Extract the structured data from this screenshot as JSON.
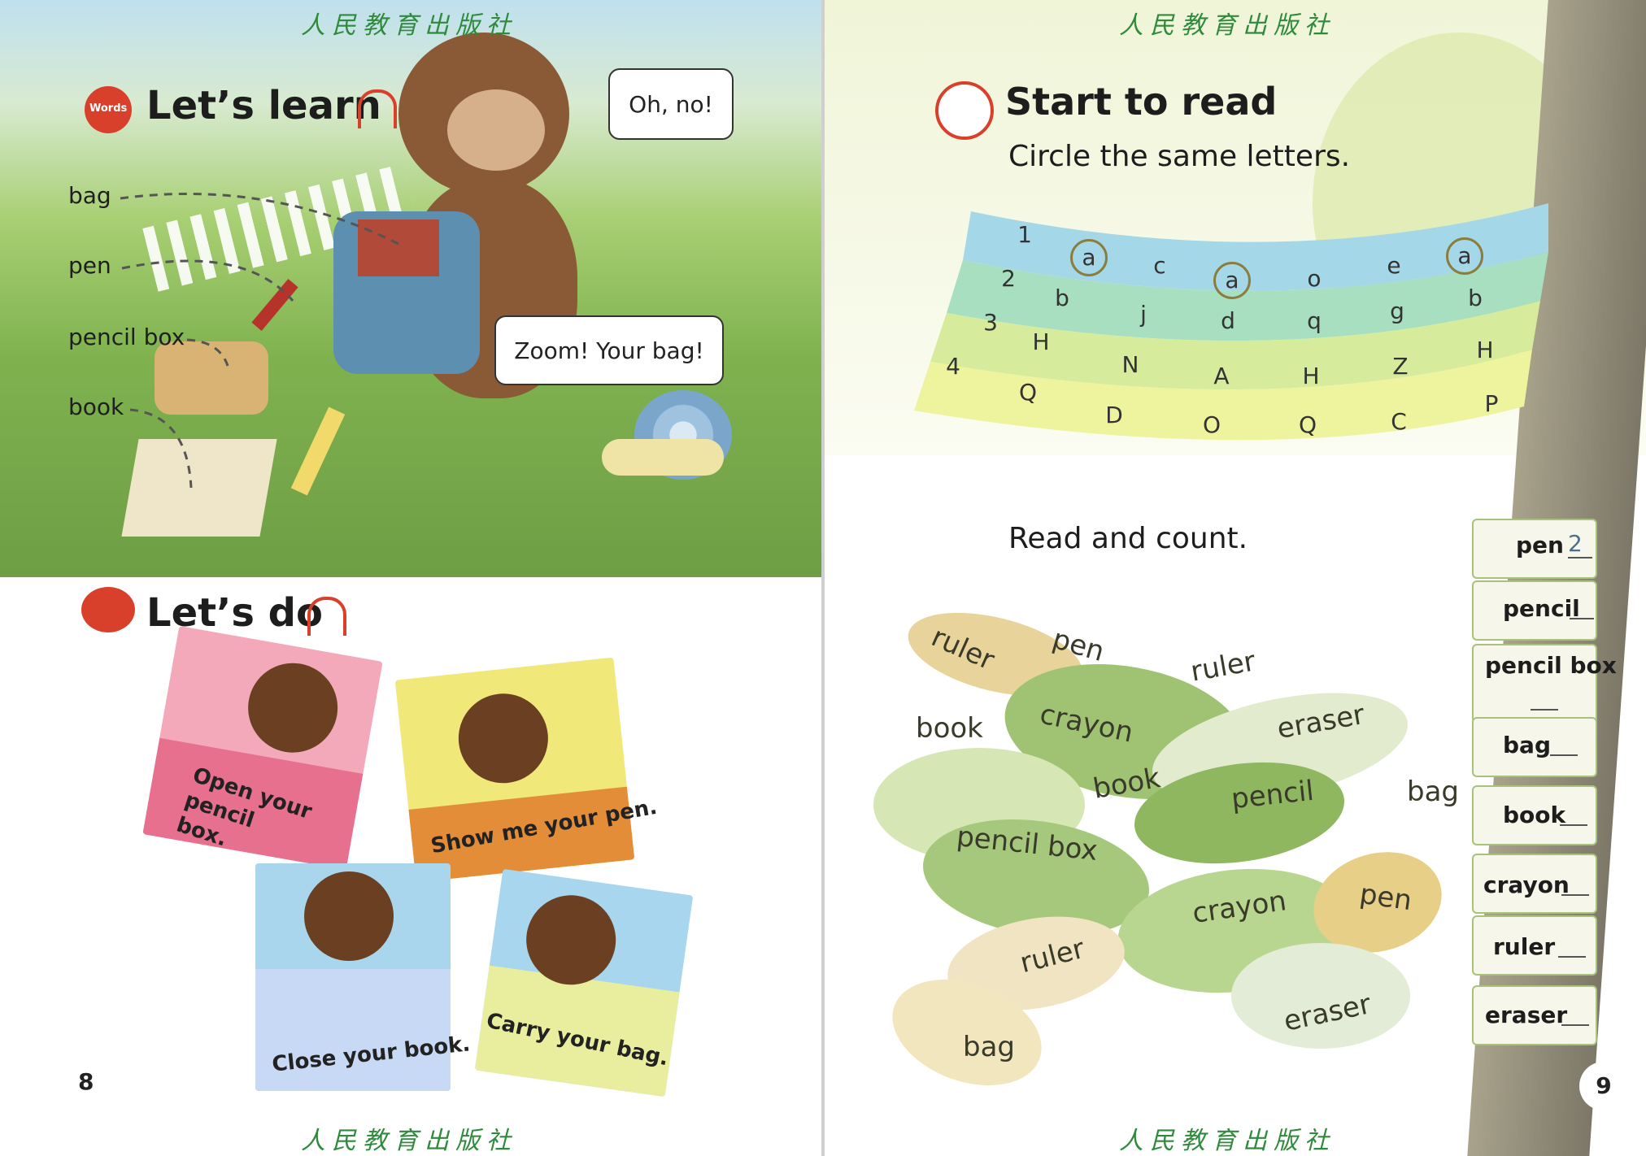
{
  "publisher": "人民教育出版社",
  "left_page": {
    "learn": {
      "title": "Let’s learn",
      "badge": "Words"
    },
    "words": [
      "bag",
      "pen",
      "pencil box",
      "book"
    ],
    "bubbles": [
      "Oh, no!",
      "Zoom! Your bag!"
    ],
    "do_title": "Let’s do",
    "cards": [
      "Open your pencil box.",
      "Show me your pen.",
      "Close your book.",
      "Carry your bag."
    ],
    "page_number": "8"
  },
  "right_page": {
    "title": "Start to read",
    "instruction1": "Circle the same letters.",
    "rows": [
      {
        "num": "1",
        "letters": [
          "a",
          "c",
          "a",
          "o",
          "e",
          "a"
        ]
      },
      {
        "num": "2",
        "letters": [
          "b",
          "j",
          "d",
          "q",
          "g",
          "b"
        ]
      },
      {
        "num": "3",
        "letters": [
          "H",
          "N",
          "A",
          "H",
          "Z",
          "H"
        ]
      },
      {
        "num": "4",
        "letters": [
          "Q",
          "D",
          "O",
          "Q",
          "C",
          "P"
        ]
      }
    ],
    "instruction2": "Read and count.",
    "leaf_words": [
      "ruler",
      "pen",
      "ruler",
      "book",
      "crayon",
      "eraser",
      "book",
      "pencil",
      "bag",
      "pencil box",
      "crayon",
      "pen",
      "ruler",
      "eraser",
      "bag"
    ],
    "tally": [
      {
        "word": "pen",
        "count": "2"
      },
      {
        "word": "pencil",
        "count": ""
      },
      {
        "word": "pencil box",
        "count": ""
      },
      {
        "word": "bag",
        "count": ""
      },
      {
        "word": "book",
        "count": ""
      },
      {
        "word": "crayon",
        "count": ""
      },
      {
        "word": "ruler",
        "count": ""
      },
      {
        "word": "eraser",
        "count": ""
      }
    ],
    "page_number": "9"
  }
}
